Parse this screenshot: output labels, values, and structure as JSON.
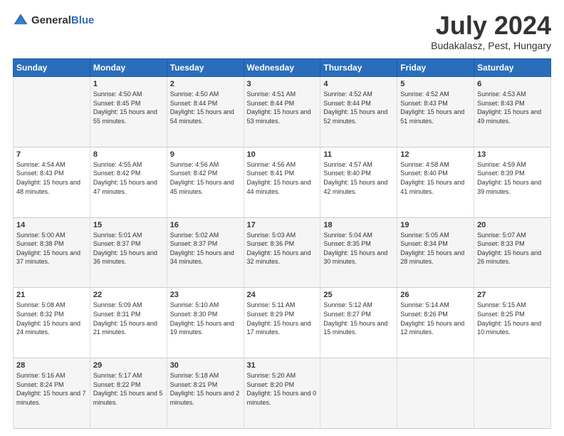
{
  "header": {
    "logo_general": "General",
    "logo_blue": "Blue",
    "title": "July 2024",
    "location": "Budakalasz, Pest, Hungary"
  },
  "weekdays": [
    "Sunday",
    "Monday",
    "Tuesday",
    "Wednesday",
    "Thursday",
    "Friday",
    "Saturday"
  ],
  "weeks": [
    [
      {
        "day": "",
        "sunrise": "",
        "sunset": "",
        "daylight": ""
      },
      {
        "day": "1",
        "sunrise": "Sunrise: 4:50 AM",
        "sunset": "Sunset: 8:45 PM",
        "daylight": "Daylight: 15 hours and 55 minutes."
      },
      {
        "day": "2",
        "sunrise": "Sunrise: 4:50 AM",
        "sunset": "Sunset: 8:44 PM",
        "daylight": "Daylight: 15 hours and 54 minutes."
      },
      {
        "day": "3",
        "sunrise": "Sunrise: 4:51 AM",
        "sunset": "Sunset: 8:44 PM",
        "daylight": "Daylight: 15 hours and 53 minutes."
      },
      {
        "day": "4",
        "sunrise": "Sunrise: 4:52 AM",
        "sunset": "Sunset: 8:44 PM",
        "daylight": "Daylight: 15 hours and 52 minutes."
      },
      {
        "day": "5",
        "sunrise": "Sunrise: 4:52 AM",
        "sunset": "Sunset: 8:43 PM",
        "daylight": "Daylight: 15 hours and 51 minutes."
      },
      {
        "day": "6",
        "sunrise": "Sunrise: 4:53 AM",
        "sunset": "Sunset: 8:43 PM",
        "daylight": "Daylight: 15 hours and 49 minutes."
      }
    ],
    [
      {
        "day": "7",
        "sunrise": "Sunrise: 4:54 AM",
        "sunset": "Sunset: 8:43 PM",
        "daylight": "Daylight: 15 hours and 48 minutes."
      },
      {
        "day": "8",
        "sunrise": "Sunrise: 4:55 AM",
        "sunset": "Sunset: 8:42 PM",
        "daylight": "Daylight: 15 hours and 47 minutes."
      },
      {
        "day": "9",
        "sunrise": "Sunrise: 4:56 AM",
        "sunset": "Sunset: 8:42 PM",
        "daylight": "Daylight: 15 hours and 45 minutes."
      },
      {
        "day": "10",
        "sunrise": "Sunrise: 4:56 AM",
        "sunset": "Sunset: 8:41 PM",
        "daylight": "Daylight: 15 hours and 44 minutes."
      },
      {
        "day": "11",
        "sunrise": "Sunrise: 4:57 AM",
        "sunset": "Sunset: 8:40 PM",
        "daylight": "Daylight: 15 hours and 42 minutes."
      },
      {
        "day": "12",
        "sunrise": "Sunrise: 4:58 AM",
        "sunset": "Sunset: 8:40 PM",
        "daylight": "Daylight: 15 hours and 41 minutes."
      },
      {
        "day": "13",
        "sunrise": "Sunrise: 4:59 AM",
        "sunset": "Sunset: 8:39 PM",
        "daylight": "Daylight: 15 hours and 39 minutes."
      }
    ],
    [
      {
        "day": "14",
        "sunrise": "Sunrise: 5:00 AM",
        "sunset": "Sunset: 8:38 PM",
        "daylight": "Daylight: 15 hours and 37 minutes."
      },
      {
        "day": "15",
        "sunrise": "Sunrise: 5:01 AM",
        "sunset": "Sunset: 8:37 PM",
        "daylight": "Daylight: 15 hours and 36 minutes."
      },
      {
        "day": "16",
        "sunrise": "Sunrise: 5:02 AM",
        "sunset": "Sunset: 8:37 PM",
        "daylight": "Daylight: 15 hours and 34 minutes."
      },
      {
        "day": "17",
        "sunrise": "Sunrise: 5:03 AM",
        "sunset": "Sunset: 8:36 PM",
        "daylight": "Daylight: 15 hours and 32 minutes."
      },
      {
        "day": "18",
        "sunrise": "Sunrise: 5:04 AM",
        "sunset": "Sunset: 8:35 PM",
        "daylight": "Daylight: 15 hours and 30 minutes."
      },
      {
        "day": "19",
        "sunrise": "Sunrise: 5:05 AM",
        "sunset": "Sunset: 8:34 PM",
        "daylight": "Daylight: 15 hours and 28 minutes."
      },
      {
        "day": "20",
        "sunrise": "Sunrise: 5:07 AM",
        "sunset": "Sunset: 8:33 PM",
        "daylight": "Daylight: 15 hours and 26 minutes."
      }
    ],
    [
      {
        "day": "21",
        "sunrise": "Sunrise: 5:08 AM",
        "sunset": "Sunset: 8:32 PM",
        "daylight": "Daylight: 15 hours and 24 minutes."
      },
      {
        "day": "22",
        "sunrise": "Sunrise: 5:09 AM",
        "sunset": "Sunset: 8:31 PM",
        "daylight": "Daylight: 15 hours and 21 minutes."
      },
      {
        "day": "23",
        "sunrise": "Sunrise: 5:10 AM",
        "sunset": "Sunset: 8:30 PM",
        "daylight": "Daylight: 15 hours and 19 minutes."
      },
      {
        "day": "24",
        "sunrise": "Sunrise: 5:11 AM",
        "sunset": "Sunset: 8:29 PM",
        "daylight": "Daylight: 15 hours and 17 minutes."
      },
      {
        "day": "25",
        "sunrise": "Sunrise: 5:12 AM",
        "sunset": "Sunset: 8:27 PM",
        "daylight": "Daylight: 15 hours and 15 minutes."
      },
      {
        "day": "26",
        "sunrise": "Sunrise: 5:14 AM",
        "sunset": "Sunset: 8:26 PM",
        "daylight": "Daylight: 15 hours and 12 minutes."
      },
      {
        "day": "27",
        "sunrise": "Sunrise: 5:15 AM",
        "sunset": "Sunset: 8:25 PM",
        "daylight": "Daylight: 15 hours and 10 minutes."
      }
    ],
    [
      {
        "day": "28",
        "sunrise": "Sunrise: 5:16 AM",
        "sunset": "Sunset: 8:24 PM",
        "daylight": "Daylight: 15 hours and 7 minutes."
      },
      {
        "day": "29",
        "sunrise": "Sunrise: 5:17 AM",
        "sunset": "Sunset: 8:22 PM",
        "daylight": "Daylight: 15 hours and 5 minutes."
      },
      {
        "day": "30",
        "sunrise": "Sunrise: 5:18 AM",
        "sunset": "Sunset: 8:21 PM",
        "daylight": "Daylight: 15 hours and 2 minutes."
      },
      {
        "day": "31",
        "sunrise": "Sunrise: 5:20 AM",
        "sunset": "Sunset: 8:20 PM",
        "daylight": "Daylight: 15 hours and 0 minutes."
      },
      {
        "day": "",
        "sunrise": "",
        "sunset": "",
        "daylight": ""
      },
      {
        "day": "",
        "sunrise": "",
        "sunset": "",
        "daylight": ""
      },
      {
        "day": "",
        "sunrise": "",
        "sunset": "",
        "daylight": ""
      }
    ]
  ]
}
